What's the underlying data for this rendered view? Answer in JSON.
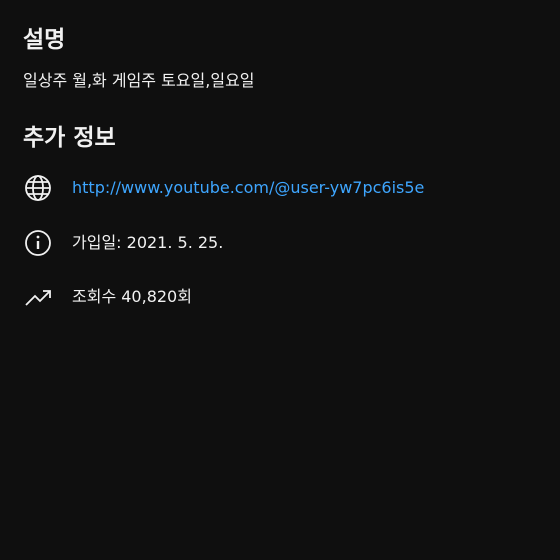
{
  "description": {
    "heading": "설명",
    "text": "일상주 월,화 게임주 토요일,일요일"
  },
  "additional_info": {
    "heading": "추가 정보",
    "link": {
      "icon": "globe-icon",
      "url": "http://www.youtube.com/@user-yw7pc6is5e"
    },
    "joined": {
      "icon": "info-icon",
      "text": "가입일: 2021. 5. 25."
    },
    "views": {
      "icon": "trending-up-icon",
      "text": "조회수 40,820회"
    }
  },
  "colors": {
    "background": "#0f0f0f",
    "text": "#f1f1f1",
    "link": "#3ea6ff"
  }
}
